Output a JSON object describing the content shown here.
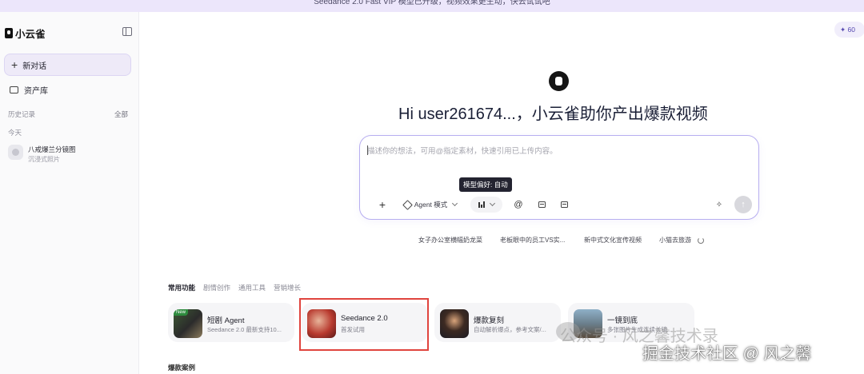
{
  "banner": {
    "text": "Seedance 2.0 Fast VIP 模型已升级，视频效果更生动，快去试试吧"
  },
  "sidebar": {
    "brand": "小云雀",
    "new_chat": "新对话",
    "assets": "资产库",
    "history_title": "历史记录",
    "history_all": "全部",
    "today": "今天",
    "history_items": [
      {
        "title": "八戒爆兰分镜图",
        "subtitle": "沉浸式照片"
      }
    ]
  },
  "credits": "✦ 60",
  "hero": {
    "title": "Hi user261674...，小云雀助你产出爆款视频"
  },
  "composer": {
    "placeholder": "描述你的想法，可用@指定素材，快速引用已上传内容。",
    "tooltip": "模型偏好: 自动",
    "agent_mode": "Agent 模式",
    "send_icon": "arrow-up-icon"
  },
  "suggestions": [
    "女子办公室横幅奶龙菜",
    "老板眼中的员工VS实...",
    "新中式文化宣传视频",
    "小猫去旅游"
  ],
  "tabs": [
    "常用功能",
    "剧情创作",
    "通用工具",
    "营销增长"
  ],
  "cards": [
    {
      "title": "短剧 Agent",
      "desc": "Seedance 2.0 最新支持10...",
      "badge": "New"
    },
    {
      "title": "Seedance 2.0",
      "desc": "首发试用"
    },
    {
      "title": "爆款复刻",
      "desc": "自动解析爆点，参考文案/..."
    },
    {
      "title": "一镜到底",
      "desc": "多张图片生成连续长镜..."
    }
  ],
  "section_title": "爆款案例",
  "watermarks": {
    "line1": "公众号 · 风之馨技术录",
    "line2": "掘金技术社区 @ 风之馨"
  },
  "colors": {
    "accent": "#b7aef0",
    "highlight": "#e0443e",
    "banner_bg": "#ece6fb"
  }
}
